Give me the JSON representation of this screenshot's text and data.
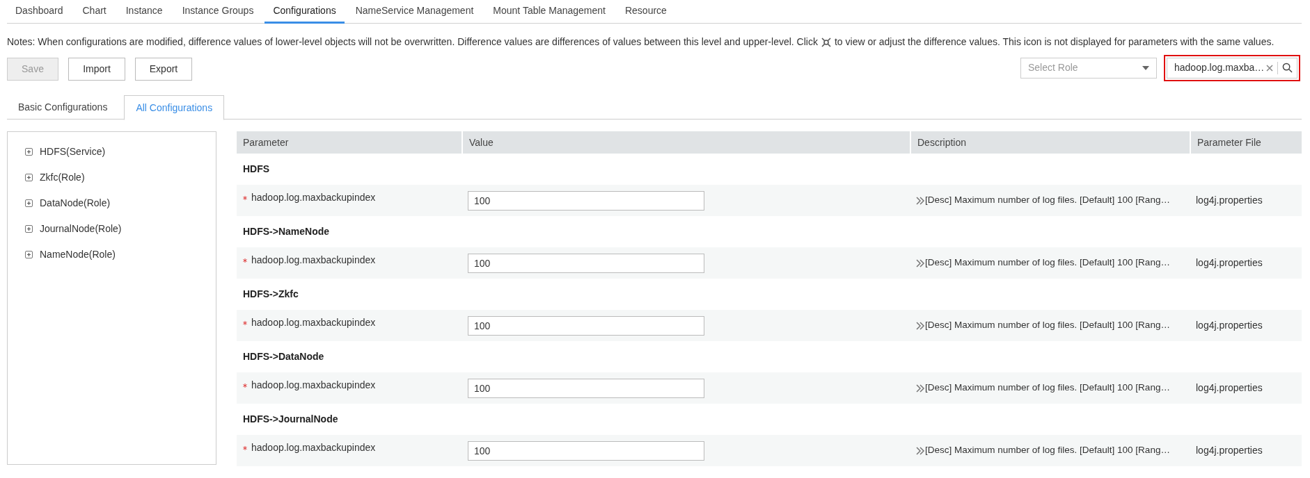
{
  "tabs": [
    {
      "label": "Dashboard",
      "selected": false
    },
    {
      "label": "Chart",
      "selected": false
    },
    {
      "label": "Instance",
      "selected": false
    },
    {
      "label": "Instance Groups",
      "selected": false
    },
    {
      "label": "Configurations",
      "selected": true
    },
    {
      "label": "NameService Management",
      "selected": false
    },
    {
      "label": "Mount Table Management",
      "selected": false
    },
    {
      "label": "Resource",
      "selected": false
    }
  ],
  "notes": {
    "before": "Notes: When configurations are modified, difference values of lower-level objects will not be overwritten. Difference values are differences of values between this level and upper-level. Click",
    "after": "to view or adjust the difference values. This icon is not displayed for parameters with the same values."
  },
  "buttons": [
    {
      "label": "Save",
      "disabled": true
    },
    {
      "label": "Import",
      "disabled": false
    },
    {
      "label": "Export",
      "disabled": false
    }
  ],
  "role_select": {
    "placeholder": "Select Role"
  },
  "search": {
    "value": "hadoop.log.maxba…"
  },
  "sub_tabs": [
    {
      "label": "Basic Configurations",
      "selected": false
    },
    {
      "label": "All Configurations",
      "selected": true
    }
  ],
  "tree": [
    {
      "label": "HDFS(Service)",
      "expanded": false
    },
    {
      "label": "Zkfc(Role)",
      "expanded": false
    },
    {
      "label": "DataNode(Role)",
      "expanded": false
    },
    {
      "label": "JournalNode(Role)",
      "expanded": false
    },
    {
      "label": "NameNode(Role)",
      "expanded": false
    }
  ],
  "table": {
    "columns": [
      "Parameter",
      "Value",
      "Description",
      "Parameter File"
    ],
    "groups": [
      {
        "title": "HDFS",
        "rows": [
          {
            "parameter": "hadoop.log.maxbackupindex",
            "required": true,
            "value": "100",
            "description": "[Desc] Maximum number of log files. [Default] 100 [Rang…",
            "file": "log4j.properties"
          }
        ]
      },
      {
        "title": "HDFS->NameNode",
        "rows": [
          {
            "parameter": "hadoop.log.maxbackupindex",
            "required": true,
            "value": "100",
            "description": "[Desc] Maximum number of log files. [Default] 100 [Rang…",
            "file": "log4j.properties"
          }
        ]
      },
      {
        "title": "HDFS->Zkfc",
        "rows": [
          {
            "parameter": "hadoop.log.maxbackupindex",
            "required": true,
            "value": "100",
            "description": "[Desc] Maximum number of log files. [Default] 100 [Rang…",
            "file": "log4j.properties"
          }
        ]
      },
      {
        "title": "HDFS->DataNode",
        "rows": [
          {
            "parameter": "hadoop.log.maxbackupindex",
            "required": true,
            "value": "100",
            "description": "[Desc] Maximum number of log files. [Default] 100 [Rang…",
            "file": "log4j.properties"
          }
        ]
      },
      {
        "title": "HDFS->JournalNode",
        "rows": [
          {
            "parameter": "hadoop.log.maxbackupindex",
            "required": true,
            "value": "100",
            "description": "[Desc] Maximum number of log files. [Default] 100 [Rang…",
            "file": "log4j.properties"
          }
        ]
      }
    ]
  }
}
